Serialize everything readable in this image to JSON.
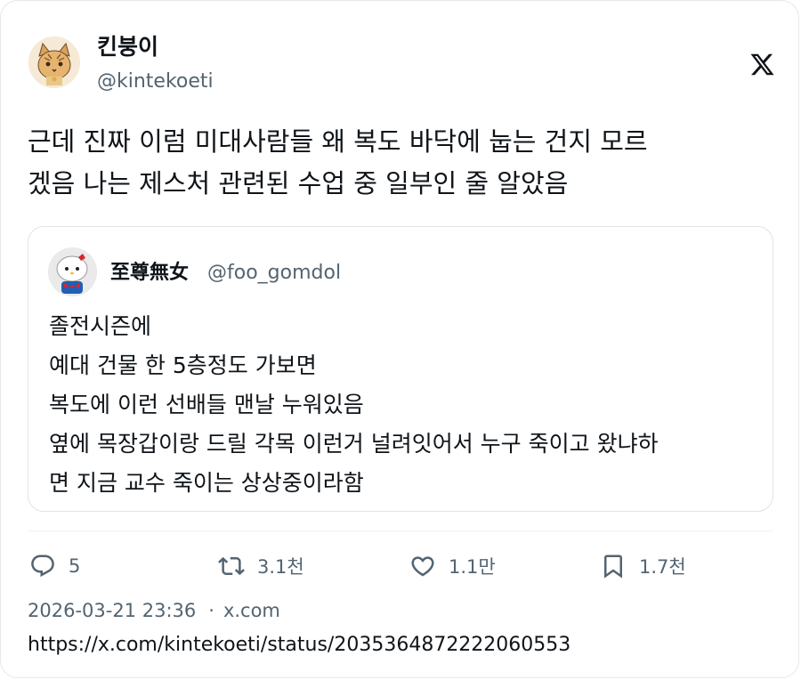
{
  "author": {
    "display_name": "킨붕이",
    "handle": "@kintekoeti"
  },
  "brand_icon": "x-logo-icon",
  "tweet": {
    "text": "근데 진짜 이럼 미대사람들 왜 복도 바닥에 눕는 건지 모르\n겠음 나는 제스처 관련된 수업 중 일부인 줄 알았음"
  },
  "quote": {
    "display_name": "至尊無女",
    "handle": "@foo_gomdol",
    "text": "졸전시즌에\n예대 건물 한 5층정도 가보면\n복도에 이런 선배들 맨날 누워있음\n옆에 목장갑이랑 드릴 각목 이런거 널려잇어서 누구 죽이고 왔냐하\n면 지금 교수 죽이는 상상중이라함"
  },
  "actions": {
    "reply": {
      "icon": "reply-icon",
      "count": "5"
    },
    "retweet": {
      "icon": "retweet-icon",
      "count": "3.1천"
    },
    "like": {
      "icon": "heart-icon",
      "count": "1.1만"
    },
    "bookmark": {
      "icon": "bookmark-icon",
      "count": "1.7천"
    }
  },
  "meta": {
    "timestamp": "2026-03-21 23:36",
    "separator": "·",
    "source": "x.com"
  },
  "status_url": "https://x.com/kintekoeti/status/2035364872222060553",
  "colors": {
    "text": "#0f1419",
    "secondary": "#536471",
    "border": "#dfe3e7"
  }
}
